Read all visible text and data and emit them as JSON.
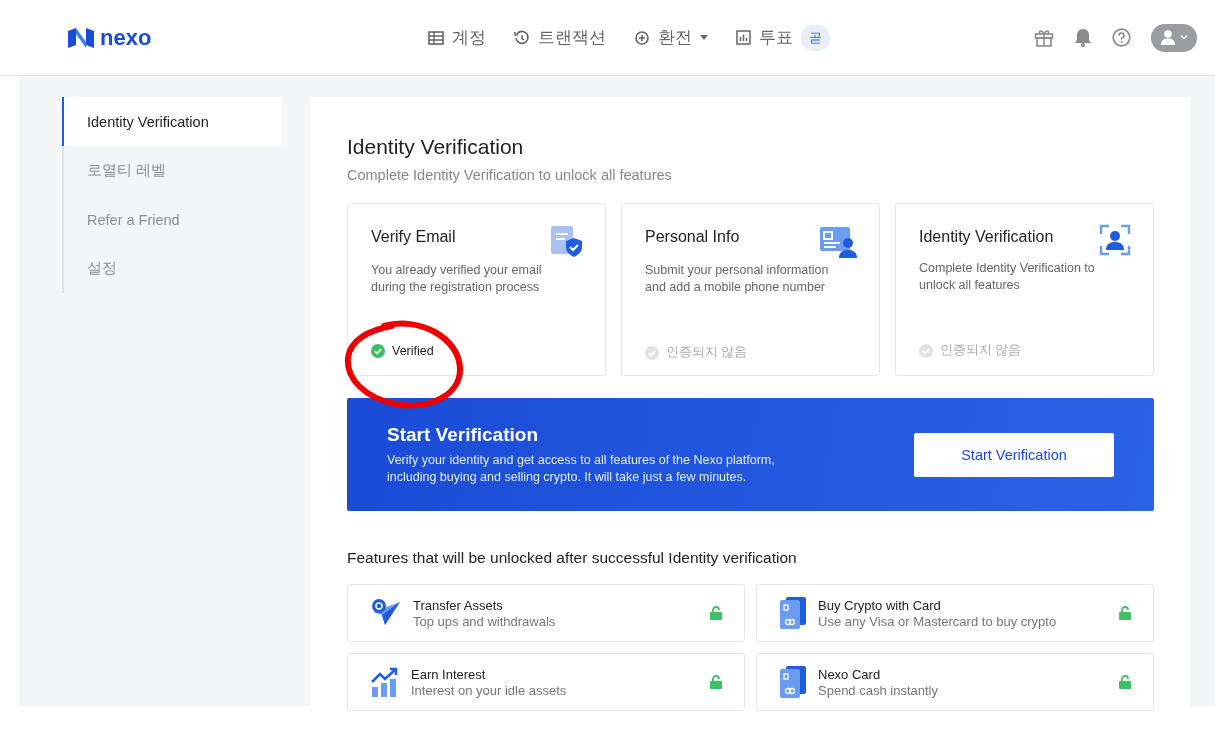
{
  "header": {
    "logo": "nexo",
    "nav": [
      {
        "label": "계정",
        "dropdown": false
      },
      {
        "label": "트랜잭션",
        "dropdown": false
      },
      {
        "label": "환전",
        "dropdown": true
      },
      {
        "label": "투표",
        "dropdown": false,
        "badge": "곧"
      }
    ]
  },
  "sidebar": {
    "items": [
      {
        "label": "Identity Verification",
        "selected": true
      },
      {
        "label": "로열티 레벨",
        "selected": false
      },
      {
        "label": "Refer a Friend",
        "selected": false
      },
      {
        "label": "설정",
        "selected": false
      }
    ]
  },
  "main": {
    "title": "Identity Verification",
    "subtitle": "Complete Identity Verification to unlock all features",
    "steps": [
      {
        "title": "Verify Email",
        "description": "You already verified your email during the registration process",
        "status": "Verified",
        "verified": true
      },
      {
        "title": "Personal Info",
        "description": "Submit your personal information and add a mobile phone number",
        "status": "인증되지 않음",
        "verified": false
      },
      {
        "title": "Identity Verification",
        "description": "Complete Identity Verification to unlock all features",
        "status": "인증되지 않음",
        "verified": false
      }
    ],
    "banner": {
      "title": "Start Verification",
      "text": "Verify your identity and get access to all features of the Nexo platform, including buying and selling crypto. It will take just a few minutes.",
      "button": "Start Verification"
    },
    "features_title": "Features that will be unlocked after successful Identity verification",
    "features": [
      {
        "title": "Transfer Assets",
        "description": "Top ups and withdrawals",
        "unlocked": true
      },
      {
        "title": "Buy Crypto with Card",
        "description": "Use any Visa or Mastercard to buy crypto",
        "unlocked": true
      },
      {
        "title": "Earn Interest",
        "description": "Interest on your idle assets",
        "unlocked": true
      },
      {
        "title": "Nexo Card",
        "description": "Spend cash instantly",
        "unlocked": true
      }
    ]
  }
}
